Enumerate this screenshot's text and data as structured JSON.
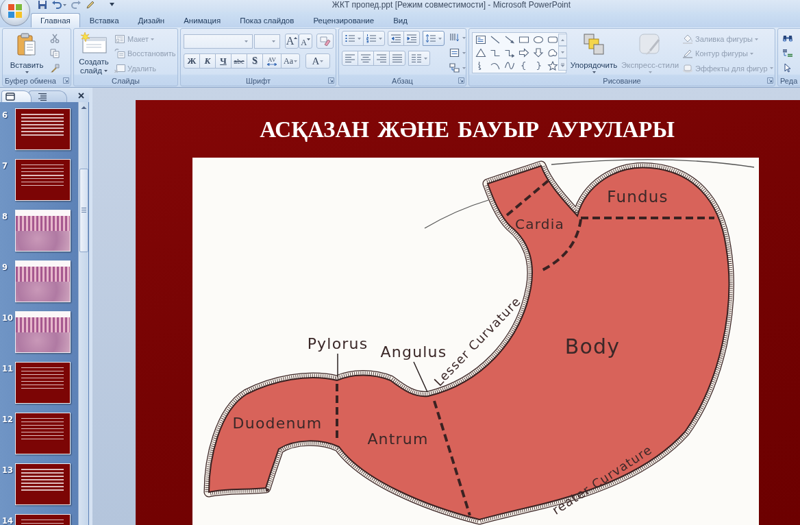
{
  "window": {
    "title": "ЖКТ пропед.ppt [Режим совместимости] - Microsoft PowerPoint"
  },
  "tabs": [
    {
      "label": "Главная",
      "selected": true
    },
    {
      "label": "Вставка",
      "selected": false
    },
    {
      "label": "Дизайн",
      "selected": false
    },
    {
      "label": "Анимация",
      "selected": false
    },
    {
      "label": "Показ слайдов",
      "selected": false
    },
    {
      "label": "Рецензирование",
      "selected": false
    },
    {
      "label": "Вид",
      "selected": false
    }
  ],
  "ribbon": {
    "clipboard": {
      "label": "Буфер обмена",
      "launcher": true,
      "paste": "Вставить"
    },
    "slides": {
      "label": "Слайды",
      "new_slide": "Создать слайд",
      "commands": [
        {
          "label": "Макет",
          "disabled": true
        },
        {
          "label": "Восстановить",
          "disabled": true
        },
        {
          "label": "Удалить",
          "disabled": true
        }
      ]
    },
    "font": {
      "label": "Шрифт",
      "launcher": true,
      "grow": "A",
      "shrink": "A",
      "format_buttons": [
        "Ж",
        "К",
        "Ч",
        "abc",
        "S",
        "AV",
        "Aa"
      ],
      "color_button": "A"
    },
    "paragraph": {
      "label": "Абзац",
      "launcher": true
    },
    "drawing": {
      "label": "Рисование",
      "launcher": true,
      "arrange": {
        "label": "Упорядочить",
        "disabled": false
      },
      "quick_styles": {
        "label": "Экспресс-стили",
        "disabled": true
      },
      "commands": [
        {
          "label": "Заливка фигуры",
          "disabled": true
        },
        {
          "label": "Контур фигуры",
          "disabled": true
        },
        {
          "label": "Эффекты для фигур",
          "disabled": true
        }
      ]
    },
    "editing": {
      "label": "Реда"
    }
  },
  "slide_panel": {
    "tabs": [
      {
        "selected": true
      },
      {
        "selected": false
      }
    ],
    "slides": [
      {
        "number": "6",
        "kind": "text",
        "selected": false
      },
      {
        "number": "7",
        "kind": "text",
        "selected": false
      },
      {
        "number": "8",
        "kind": "micrograph",
        "selected": false
      },
      {
        "number": "9",
        "kind": "micrograph",
        "selected": false
      },
      {
        "number": "10",
        "kind": "micrograph",
        "selected": false
      },
      {
        "number": "11",
        "kind": "text",
        "selected": false
      },
      {
        "number": "12",
        "kind": "text",
        "selected": false
      },
      {
        "number": "13",
        "kind": "text",
        "selected": false
      },
      {
        "number": "14",
        "kind": "text",
        "selected": false
      }
    ]
  },
  "slide": {
    "title": "АСҚАЗАН ЖӘНЕ БАУЫР АУРУЛАРЫ",
    "diagram_labels": [
      "Fundus",
      "Cardia",
      "Pylorus",
      "Angulus",
      "Lesser Curvature",
      "Body",
      "Duodenum",
      "Antrum",
      "reater Curvature"
    ]
  }
}
